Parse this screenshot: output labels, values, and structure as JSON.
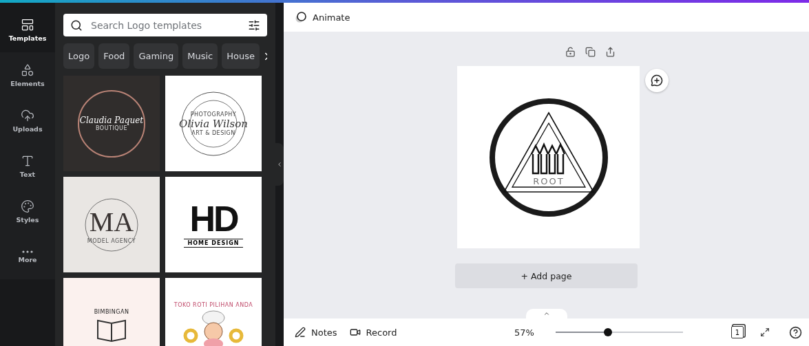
{
  "sidebar": {
    "items": [
      {
        "kind": "templates",
        "label": "Templates",
        "selected": true
      },
      {
        "kind": "elements",
        "label": "Elements",
        "selected": false
      },
      {
        "kind": "uploads",
        "label": "Uploads",
        "selected": false
      },
      {
        "kind": "text",
        "label": "Text",
        "selected": false
      },
      {
        "kind": "styles",
        "label": "Styles",
        "selected": false
      },
      {
        "kind": "more",
        "label": "More",
        "selected": false
      }
    ]
  },
  "search": {
    "placeholder": "Search Logo templates"
  },
  "categories": [
    "Logo",
    "Food",
    "Gaming",
    "Music",
    "House"
  ],
  "templates": [
    {
      "kind": "script-ring",
      "title": "Claudia Paquet",
      "subtitle": "BOUTIQUE"
    },
    {
      "kind": "stamp",
      "title": "Olivia Wilson",
      "subtitle": "PHOTOGRAPHY",
      "footer": "ART & DESIGN"
    },
    {
      "kind": "monogram",
      "title": "MA",
      "subtitle": "MODEL AGENCY"
    },
    {
      "kind": "bold-letters",
      "title": "HD",
      "subtitle": "HOME DESIGN"
    },
    {
      "kind": "book",
      "title": "BIMBINGAN"
    },
    {
      "kind": "chef",
      "title": "TOKO ROTI PILIHAN ANDA"
    }
  ],
  "header": {
    "animate": "Animate"
  },
  "canvas": {
    "logo_text": "ROOT"
  },
  "add_page": "+ Add page",
  "footer": {
    "notes": "Notes",
    "record": "Record",
    "zoom": "57%",
    "zoom_slider": {
      "level": 0.41
    },
    "page_count": "1"
  }
}
